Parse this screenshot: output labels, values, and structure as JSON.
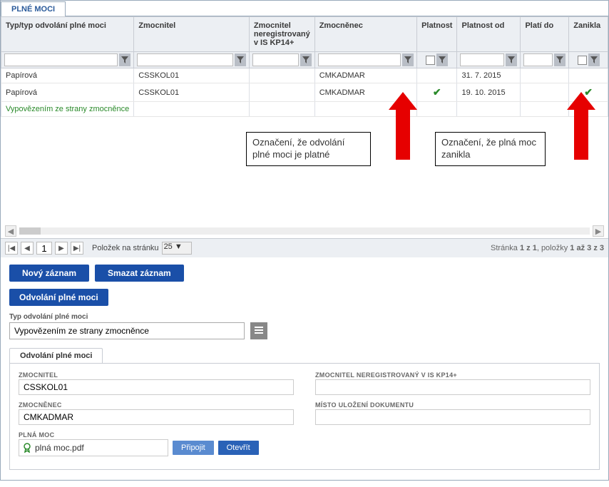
{
  "tab": {
    "title": "PLNÉ MOCI"
  },
  "grid": {
    "headers": {
      "type": "Typ/typ odvolání plné moci",
      "zmocnitel": "Zmocnitel",
      "nereg": "Zmocnitel neregistrovaný v IS KP14+",
      "zmocnenec": "Zmocněnec",
      "platnost": "Platnost",
      "platnost_od": "Platnost od",
      "plati_do": "Platí do",
      "zanikla": "Zanikla"
    },
    "rows": [
      {
        "type": "Papírová",
        "zmocnitel": "CSSKOL01",
        "nereg": "",
        "zmocnenec": "CMKADMAR",
        "platnost": "",
        "platnost_od": "31. 7. 2015",
        "plati_do": "",
        "zanikla": ""
      },
      {
        "type": "Papírová",
        "zmocnitel": "CSSKOL01",
        "nereg": "",
        "zmocnenec": "CMKADMAR",
        "platnost": "✔",
        "platnost_od": "19. 10. 2015",
        "plati_do": "",
        "zanikla": "✔"
      },
      {
        "type_link": "Vypovězením ze strany zmocněnce",
        "zmocnitel": "",
        "nereg": "",
        "zmocnenec": "",
        "platnost": "",
        "platnost_od": "",
        "plati_do": "",
        "zanikla": ""
      }
    ]
  },
  "pager": {
    "page": "1",
    "items_label": "Položek na stránku",
    "items_value": "25",
    "summary_prefix": "Stránka ",
    "summary_page": "1 z 1",
    "summary_mid": ", položky ",
    "summary_items": "1 až 3 z 3"
  },
  "actions": {
    "new": "Nový záznam",
    "delete": "Smazat záznam"
  },
  "section": {
    "title": "Odvolání plné moci"
  },
  "form": {
    "type_label": "Typ odvolání plné moci",
    "type_value": "Vypovězením ze strany zmocněnce",
    "inner_tab": "Odvolání plné moci",
    "zmocnitel_label": "ZMOCNITEL",
    "zmocnitel_value": "CSSKOL01",
    "nereg_label": "ZMOCNITEL NEREGISTROVANÝ V IS KP14+",
    "nereg_value": "",
    "zmocnenec_label": "ZMOCNĚNEC",
    "zmocnenec_value": "CMKADMAR",
    "misto_label": "MÍSTO ULOŽENÍ DOKUMENTU",
    "misto_value": "",
    "file_label": "PLNÁ MOC",
    "file_name": "plná moc.pdf",
    "attach": "Připojit",
    "open": "Otevřít"
  },
  "annotations": {
    "left": "Označení, že odvolání plné moci je platné",
    "right": "Označení, že plná moc zanikla"
  }
}
